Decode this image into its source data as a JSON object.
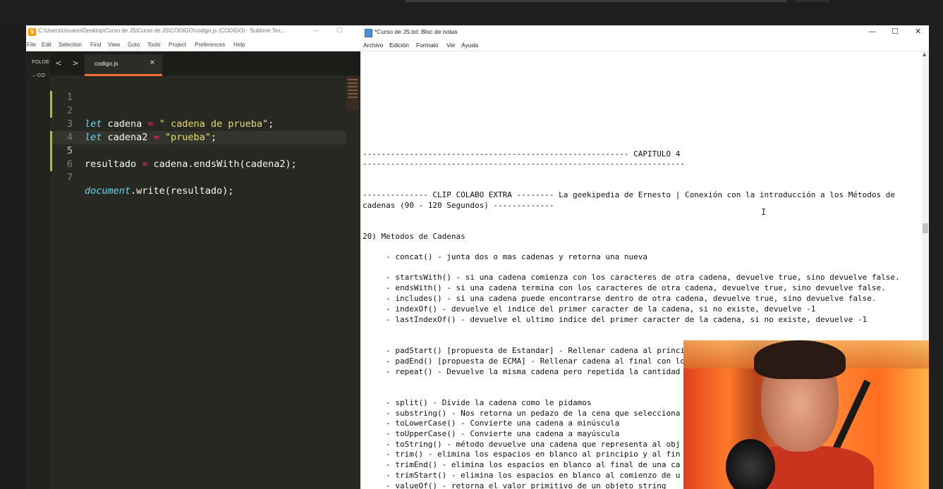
{
  "sublime": {
    "title": "C:\\Users\\Usuario\\Desktop\\Curso de JS\\Curso de JS\\CODIGO\\codigo.js (CODIGO) - Sublime Tex...",
    "logo_glyph": "S",
    "minimize": "—",
    "maximize": "☐",
    "menu": [
      "File",
      "Edit",
      "Selection",
      "Find",
      "View",
      "Goto",
      "Tools",
      "Project",
      "Preferences",
      "Help"
    ],
    "sidebar": {
      "folders_label": "FOLDE",
      "folder_item": "⌵ CO"
    },
    "nav_back": "<",
    "nav_forward": ">",
    "tab": {
      "name": "codigo.js",
      "close": "✕"
    },
    "code": {
      "line_numbers": [
        "1",
        "2",
        "3",
        "4",
        "5",
        "6",
        "7"
      ],
      "l2_kw": "let",
      "l2_var": " cadena ",
      "l2_op": "=",
      "l2_str": " \" cadena de prueba\"",
      "l2_end": ";",
      "l3_kw": "let",
      "l3_var": " cadena2 ",
      "l3_op": "=",
      "l3_str": " \"prueba\"",
      "l3_end": ";",
      "l5_var": "resultado ",
      "l5_op": "=",
      "l5_rest": " cadena.endsWith(cadena2);",
      "l7_obj": "document",
      "l7_rest": ".write(resultado);"
    }
  },
  "notepad": {
    "title": "*Curso de JS.txt: Bloc de notas",
    "controls": {
      "minimize": "—",
      "maximize": "☐",
      "close": "✕"
    },
    "menu": [
      "Archivo",
      "Edición",
      "Formato",
      "Ver",
      "Ayuda"
    ],
    "lines": [
      "--------------------------------------------------------- CAPITULO 4",
      "---------------------------------------------------------------------",
      "-------------- CLIP COLABO EXTRA -------- La geekipedia de Ernesto | Conexión con la introducción a los Métodos de",
      "cadenas (90 - 120 Segundos) -------------",
      "20) Metodos de Cadenas",
      "     - concat() - junta dos o mas cadenas y retorna una nueva",
      "     - startsWith() - si una cadena comienza con los caracteres de otra cadena, devuelve true, sino devuelve false.",
      "     - endsWith() - si una cadena termina con los caracteres de otra cadena, devuelve true, sino devuelve false.",
      "     - includes() - si una cadena puede encontrarse dentro de otra cadena, devuelve true, sino devuelve false.",
      "     - indexOf() - devuelve el indice del primer caracter de la cadena, si no existe, devuelve -1",
      "     - lastIndexOf() - devuelve el ultimo indice del primer caracter de la cadena, si no existe, devuelve -1",
      "     - padStart() [propuesta de Estandar] - Rellenar cadena al principio con los caracteres deseados.",
      "     - padEnd() [propuesta de ECMA] - Rellenar cadena al final con los caracteres deseados.",
      "     - repeat() - Devuelve la misma cadena pero repetida la cantidad",
      "     - split() - Divide la cadena como le pidamos",
      "     - substring() - Nos retorna un pedazo de la cena que selecciona",
      "     - toLowerCase() - Convierte una cadena a minúscula",
      "     - toUpperCase() - Convierte una cadena a mayúscula",
      "     - toString() - método devuelve una cadena que representa al obj",
      "     - trim() - elimina los espacios en blanco al principio y al fin",
      "     - trimEnd() - elimina los espacios en blanco al final de una ca",
      "     - trimStart() - elimina los espacios en blanco al comienzo de u",
      "     - valueOf() - retorna el valor primitivo de un objeto string"
    ],
    "scroll_up": "▲",
    "text_cursor": "I"
  },
  "colors": {
    "sublime_bg": "#272822",
    "keyword": "#66d9ef",
    "string": "#e6db74",
    "operator": "#f92672",
    "tab_accent": "#f26d3a",
    "modified_marker": "#a6c91a"
  }
}
